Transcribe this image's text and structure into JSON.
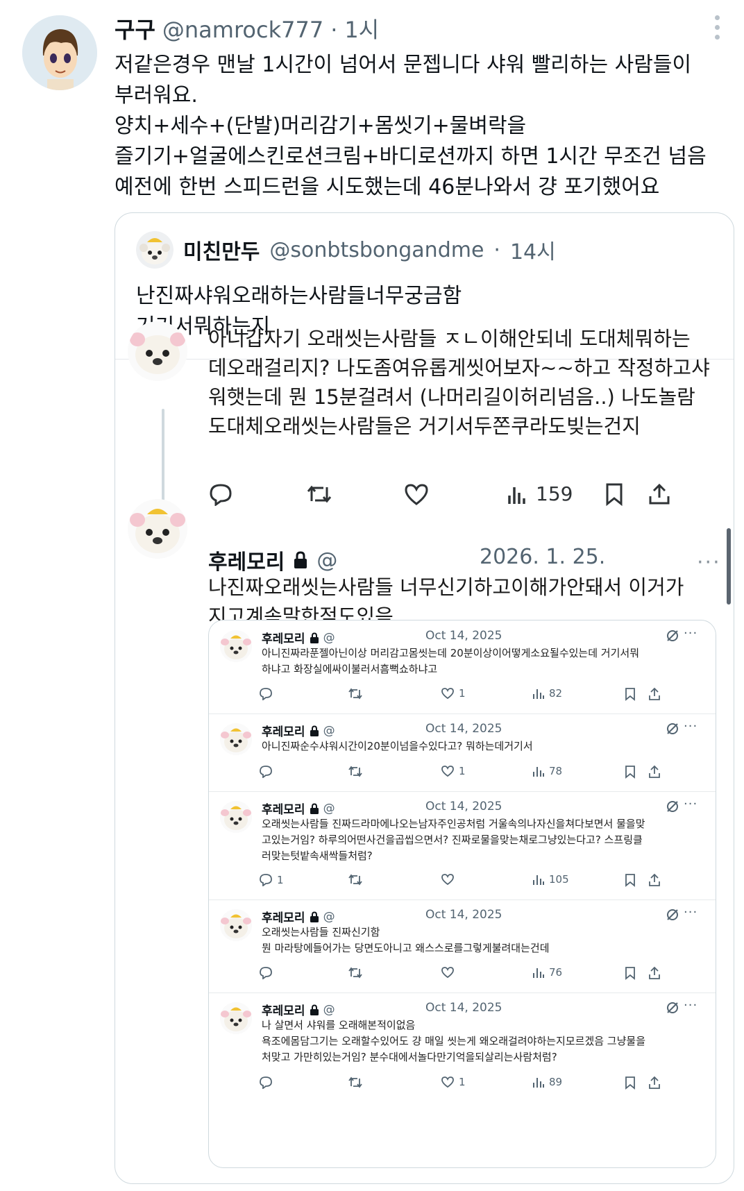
{
  "main_post": {
    "display_name": "구구",
    "handle": "@namrock777",
    "separator": "·",
    "time": "1시",
    "lines": [
      "저같은경우 맨날 1시간이 넘어서 문젭니다 샤워 빨리하는 사람들이",
      "부러워요.",
      "양치+세수+(단발)머리감기+몸씻기+물벼락을",
      "즐기기+얼굴에스킨로션크림+바디로션까지 하면 1시간 무조건 넘음",
      "예전에 한번 스피드런을 시도했는데 46분나와서 걍 포기했어요"
    ],
    "menu_icon": "more-vertical-icon"
  },
  "quoted_post": {
    "display_name": "미친만두",
    "handle": "@sonbtsbongandme",
    "separator": "·",
    "time": "14시",
    "lines": [
      "난진짜샤워오래하는사람들너무궁금함",
      "거기서뭐하는지"
    ],
    "screenshot": {
      "tweet1": {
        "lines": [
          "아니갑자기 오래씻는사람들 ㅈㄴ이해안되네 도대체뭐하는",
          "데오래걸리지? 나도좀여유롭게씻어보자~~하고 작정하고샤",
          "워햇는데 뭔 15분걸려서 (나머리길이허리넘음..) 나도놀람",
          "도대체오래씻는사람들은 거기서두쫀쿠라도빚는건지"
        ],
        "views": "159"
      },
      "tweet2": {
        "display_name": "후레모리",
        "handle": "@",
        "date": "2026. 1. 25.",
        "more": "···",
        "lines": [
          "나진짜오래씻는사람들 너무신기하고이해가안돼서 이거가",
          "지고계속말한적도있음"
        ]
      },
      "embedded_tweets": [
        {
          "name": "후레모리",
          "handle": "@",
          "date": "Oct 14, 2025",
          "lines": [
            "아니진짜라푼젤아닌이상 머리감고몸씻는데 20분이상이어떻게소요될수있는데 거기서뭐",
            "하냐고 화장실에싸이불러서흠뻑쇼하냐고"
          ],
          "replies": "",
          "likes": "1",
          "views": "82"
        },
        {
          "name": "후레모리",
          "handle": "@",
          "date": "Oct 14, 2025",
          "lines": [
            "아니진짜순수샤워시간이20분이넘을수있다고? 뭐하는데거기서"
          ],
          "replies": "",
          "likes": "1",
          "views": "78"
        },
        {
          "name": "후레모리",
          "handle": "@",
          "date": "Oct 14, 2025",
          "lines": [
            "오래씻는사람들 진짜드라마에나오는남자주인공처럼 거울속의나자신을쳐다보면서 물을맞",
            "고있는거임? 하루의어떤사건을곱씹으면서? 진짜로물을맞는채로그냥있는다고? 스프링클",
            "러맞는텃밭속새싹들처럼?"
          ],
          "replies": "1",
          "likes": "",
          "views": "105"
        },
        {
          "name": "후레모리",
          "handle": "@",
          "date": "Oct 14, 2025",
          "lines": [
            "오래씻는사람들 진짜신기함",
            "뭔 마라탕에들어가는 당면도아니고 왜스스로를그렇게불려대는건데"
          ],
          "replies": "",
          "likes": "",
          "views": "76"
        },
        {
          "name": "후레모리",
          "handle": "@",
          "date": "Oct 14, 2025",
          "lines": [
            "나 살면서 샤워를 오래해본적이없음",
            "욕조에몸담그기는 오래할수있어도 걍 매일 씻는게 왜오래걸려야하는지모르겠음 그냥물을",
            "처맞고 가만히있는거임? 분수대에서놀다만기억을되살리는사람처럼?"
          ],
          "replies": "",
          "likes": "1",
          "views": "89"
        }
      ]
    }
  },
  "colors": {
    "text": "#0f1419",
    "secondary": "#536471",
    "border": "#cfd9de"
  }
}
